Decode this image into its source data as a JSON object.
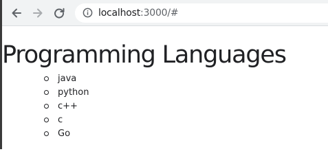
{
  "browser": {
    "url_host": "localhost",
    "url_rest": ":3000/#",
    "back_icon": "arrow-left-icon",
    "forward_icon": "arrow-right-icon",
    "reload_icon": "reload-icon",
    "info_icon": "info-circle-icon"
  },
  "page": {
    "title": "Programming Languages",
    "languages": [
      "java",
      "python",
      "c++",
      "c",
      "Go"
    ]
  }
}
